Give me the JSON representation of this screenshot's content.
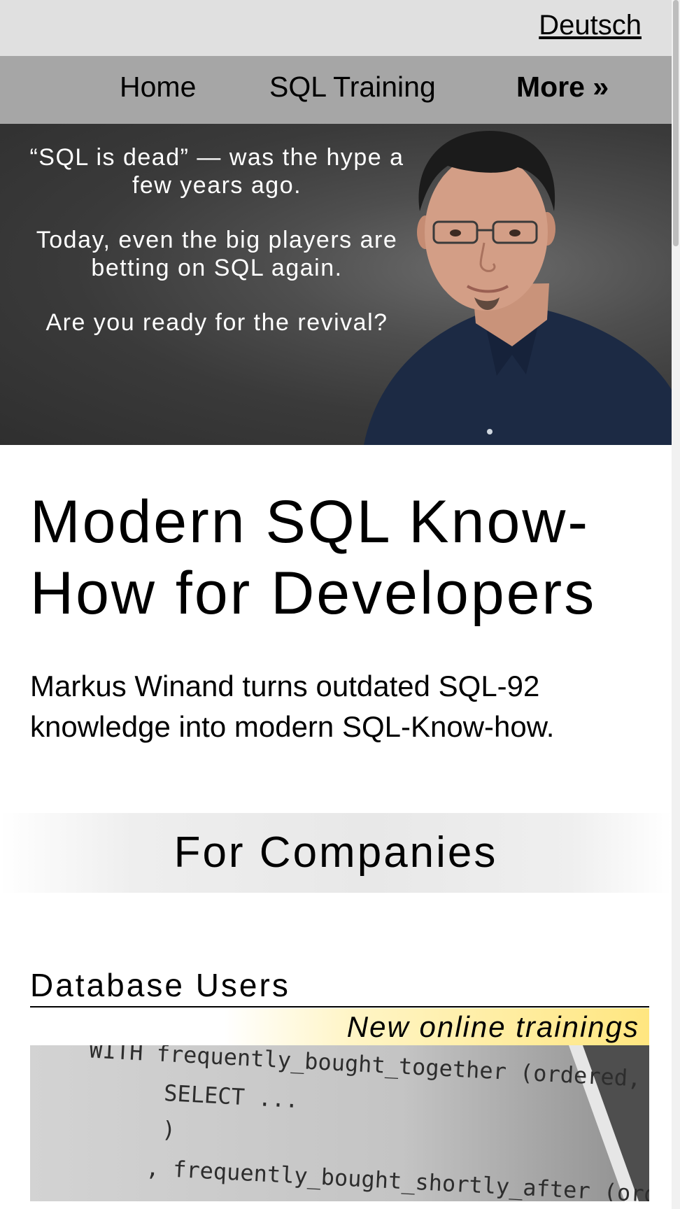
{
  "header": {
    "language_link": "Deutsch"
  },
  "nav": {
    "items": [
      {
        "label": "Home"
      },
      {
        "label": "SQL Training"
      },
      {
        "label": "More »"
      }
    ]
  },
  "hero": {
    "paragraphs": [
      "“SQL is dead” — was the hype a few years ago.",
      "Today, even the big players are betting on SQL again.",
      "Are you ready for the revival?"
    ]
  },
  "main": {
    "title": "Modern SQL Know-How for Developers",
    "intro": "Markus Winand turns outdated SQL-92 knowledge into modern SQL-Know-how."
  },
  "companies": {
    "heading": "For Companies",
    "subheading": "Database Users",
    "badge": "New online trainings",
    "code_lines": [
      "WITH frequently_bought_together (ordered, suggested, times) AS (",
      "SELECT ...",
      ")",
      ", frequently_bought_shortly_after (ordered, suggested, times"
    ]
  }
}
